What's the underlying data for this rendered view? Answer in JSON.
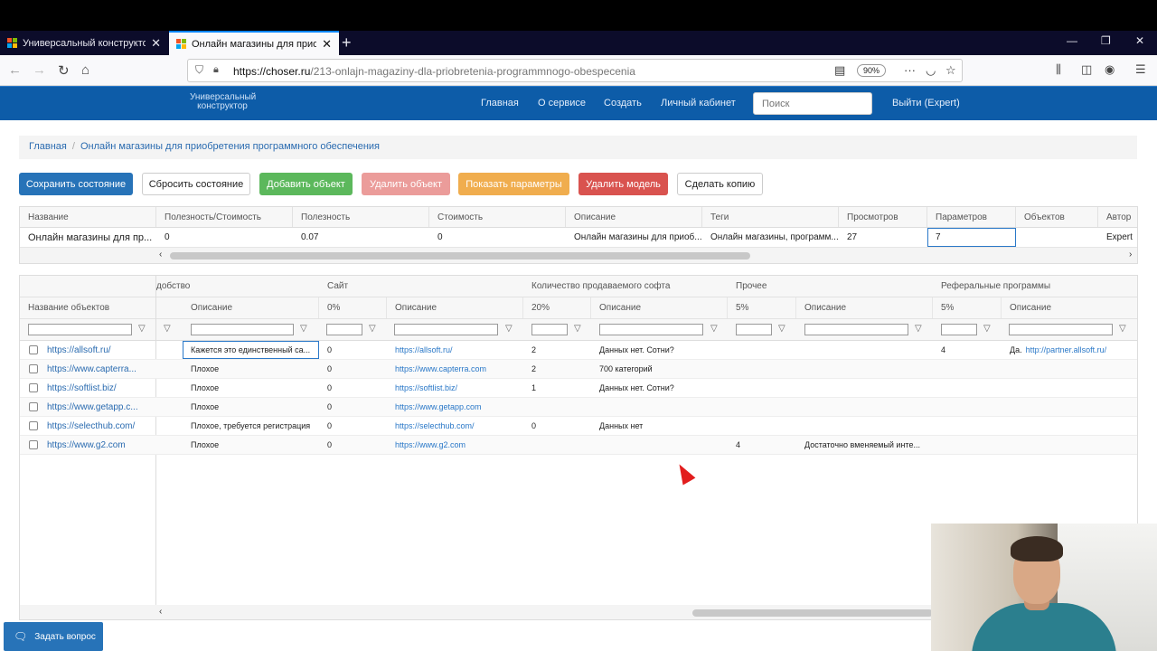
{
  "browser": {
    "tabs": [
      {
        "title": "Универсальный конструктор",
        "active": false
      },
      {
        "title": "Онлайн магазины для приоб",
        "active": true
      }
    ],
    "url_domain": "https://choser.ru",
    "url_path": "/213-onlajn-magaziny-dla-priobretenia-programmnogo-obespecenia",
    "zoom": "90%"
  },
  "site": {
    "brand": "Универсальный конструктор",
    "nav": [
      "Главная",
      "О сервисе",
      "Создать",
      "Личный кабинет"
    ],
    "search_placeholder": "Поиск",
    "logout": "Выйти (Expert)"
  },
  "breadcrumb": [
    "Главная",
    "Онлайн магазины для приобретения программного обеспечения"
  ],
  "buttons": {
    "save": "Сохранить состояние",
    "reset": "Сбросить состояние",
    "add": "Добавить объект",
    "delete": "Удалить объект",
    "params": "Показать параметры",
    "delete_model": "Удалить модель",
    "copy": "Сделать копию"
  },
  "model_table": {
    "headers": [
      "Название",
      "Полезность/Стоимость",
      "Полезность",
      "Стоимость",
      "Описание",
      "Теги",
      "Просмотров",
      "Параметров",
      "Объектов",
      "Автор"
    ],
    "row": [
      "Онлайн магазины для пр...",
      "0",
      "0.07",
      "0",
      "Онлайн магазины для приоб...",
      "Онлайн магазины, программ...",
      "27",
      "7",
      "",
      "Expert"
    ]
  },
  "objects_table": {
    "bands": [
      "добство",
      "Сайт",
      "Количество продаваемого софта",
      "Прочее",
      "Реферальные программы"
    ],
    "headers": [
      "Название объектов",
      "Описание",
      "0%",
      "Описание",
      "20%",
      "Описание",
      "5%",
      "Описание",
      "5%",
      "Описание"
    ],
    "rows": [
      {
        "name": "https://allsoft.ru/",
        "c1": "Кажется это единственный са...",
        "c2": "0",
        "c3": "https://allsoft.ru/",
        "c4": "2",
        "c5": "Данных нет. Сотни?",
        "c6": "",
        "c7": "",
        "c8": "4",
        "c9a": "Да.",
        "c9b": "http://partner.allsoft.ru/"
      },
      {
        "name": "https://www.capterra...",
        "c1": "Плохое",
        "c2": "0",
        "c3": "https://www.capterra.com",
        "c4": "2",
        "c5": "700 категорий",
        "c6": "",
        "c7": "",
        "c8": "",
        "c9a": "",
        "c9b": ""
      },
      {
        "name": "https://softlist.biz/",
        "c1": "Плохое",
        "c2": "0",
        "c3": "https://softlist.biz/",
        "c4": "1",
        "c5": "Данных нет. Сотни?",
        "c6": "",
        "c7": "",
        "c8": "",
        "c9a": "",
        "c9b": ""
      },
      {
        "name": "https://www.getapp.c...",
        "c1": "Плохое",
        "c2": "0",
        "c3": "https://www.getapp.com",
        "c4": "",
        "c5": "",
        "c6": "",
        "c7": "",
        "c8": "",
        "c9a": "",
        "c9b": ""
      },
      {
        "name": "https://selecthub.com/",
        "c1": "Плохое, требуется регистрация",
        "c2": "0",
        "c3": "https://selecthub.com/",
        "c4": "0",
        "c5": "Данных нет",
        "c6": "",
        "c7": "",
        "c8": "",
        "c9a": "",
        "c9b": ""
      },
      {
        "name": "https://www.g2.com",
        "c1": "Плохое",
        "c2": "0",
        "c3": "https://www.g2.com",
        "c4": "",
        "c5": "",
        "c6": "4",
        "c7": "Достаточно вменяемый инте...",
        "c8": "",
        "c9a": "",
        "c9b": ""
      }
    ]
  },
  "ask_button": "Задать вопрос",
  "colors": {
    "header": "#0d5ca8",
    "primary": "#2773b8",
    "success": "#5cb85c",
    "warning": "#f0ad4e",
    "danger": "#d9534f"
  }
}
